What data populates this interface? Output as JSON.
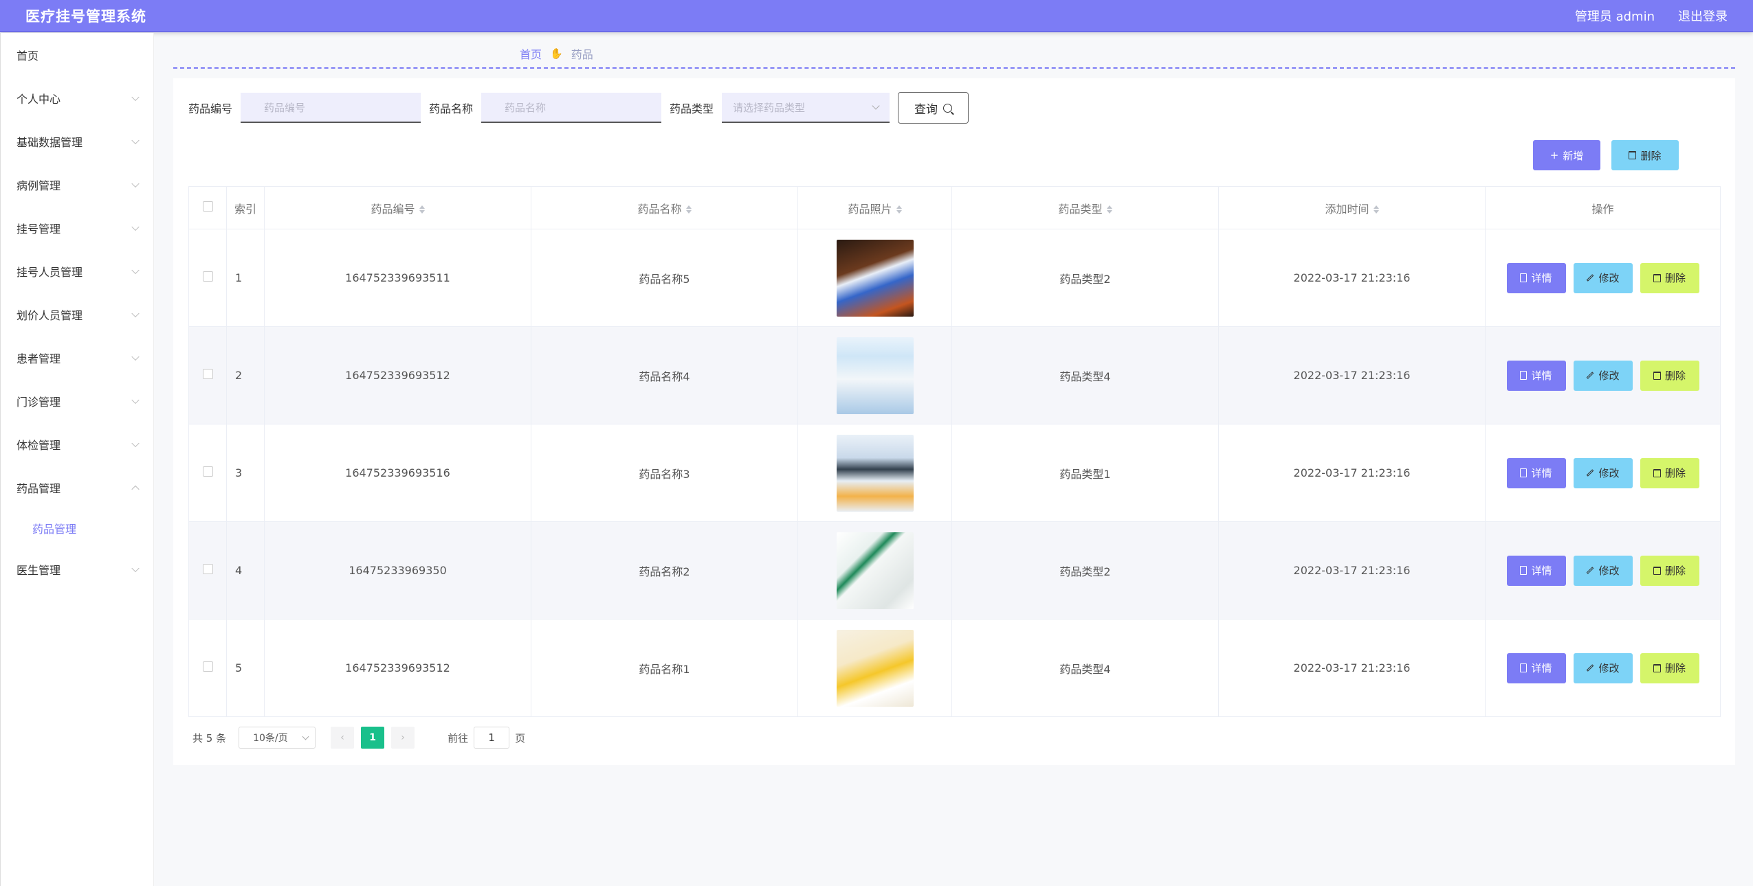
{
  "app": {
    "title": "医疗挂号管理系统",
    "user": "管理员 admin",
    "logout": "退出登录"
  },
  "sidebar": {
    "items": [
      {
        "label": "首页",
        "has_children": false
      },
      {
        "label": "个人中心",
        "has_children": true
      },
      {
        "label": "基础数据管理",
        "has_children": true
      },
      {
        "label": "病例管理",
        "has_children": true
      },
      {
        "label": "挂号管理",
        "has_children": true
      },
      {
        "label": "挂号人员管理",
        "has_children": true
      },
      {
        "label": "划价人员管理",
        "has_children": true
      },
      {
        "label": "患者管理",
        "has_children": true
      },
      {
        "label": "门诊管理",
        "has_children": true
      },
      {
        "label": "体检管理",
        "has_children": true
      },
      {
        "label": "药品管理",
        "has_children": true,
        "open": true
      },
      {
        "label": "医生管理",
        "has_children": true
      }
    ],
    "sub_active": "药品管理"
  },
  "breadcrumb": {
    "home": "首页",
    "current": "药品"
  },
  "search": {
    "code_label": "药品编号",
    "code_placeholder": "药品编号",
    "name_label": "药品名称",
    "name_placeholder": "药品名称",
    "type_label": "药品类型",
    "type_placeholder": "请选择药品类型",
    "query_button": "查询"
  },
  "actions": {
    "add": "新增",
    "delete": "删除"
  },
  "table": {
    "headers": {
      "index": "索引",
      "code": "药品编号",
      "name": "药品名称",
      "photo": "药品照片",
      "type": "药品类型",
      "time": "添加时间",
      "ops": "操作"
    },
    "op_labels": {
      "detail": "详情",
      "edit": "修改",
      "delete": "删除"
    },
    "rows": [
      {
        "index": "1",
        "code": "164752339693511",
        "name": "药品名称5",
        "type": "药品类型2",
        "time": "2022-03-17 21:23:16",
        "photo": "medicine-box-photo"
      },
      {
        "index": "2",
        "code": "164752339693512",
        "name": "药品名称4",
        "type": "药品类型4",
        "time": "2022-03-17 21:23:16",
        "photo": "supplement-bottle-photo"
      },
      {
        "index": "3",
        "code": "164752339693516",
        "name": "药品名称3",
        "type": "药品类型1",
        "time": "2022-03-17 21:23:16",
        "photo": "capsule-bottles-photo"
      },
      {
        "index": "4",
        "code": "16475233969350",
        "name": "药品名称2",
        "type": "药品类型2",
        "time": "2022-03-17 21:23:16",
        "photo": "pill-box-photo"
      },
      {
        "index": "5",
        "code": "164752339693512",
        "name": "药品名称1",
        "type": "药品类型4",
        "time": "2022-03-17 21:23:16",
        "photo": "herbal-package-photo"
      }
    ]
  },
  "pagination": {
    "total": "共 5 条",
    "page_size": "10条/页",
    "current_page": "1",
    "goto_prefix": "前往",
    "goto_value": "1",
    "goto_suffix": "页"
  },
  "colors": {
    "primary": "#7c7cf5",
    "info": "#7dd3f7",
    "danger": "#d5f56a",
    "active_page": "#19c08b"
  }
}
